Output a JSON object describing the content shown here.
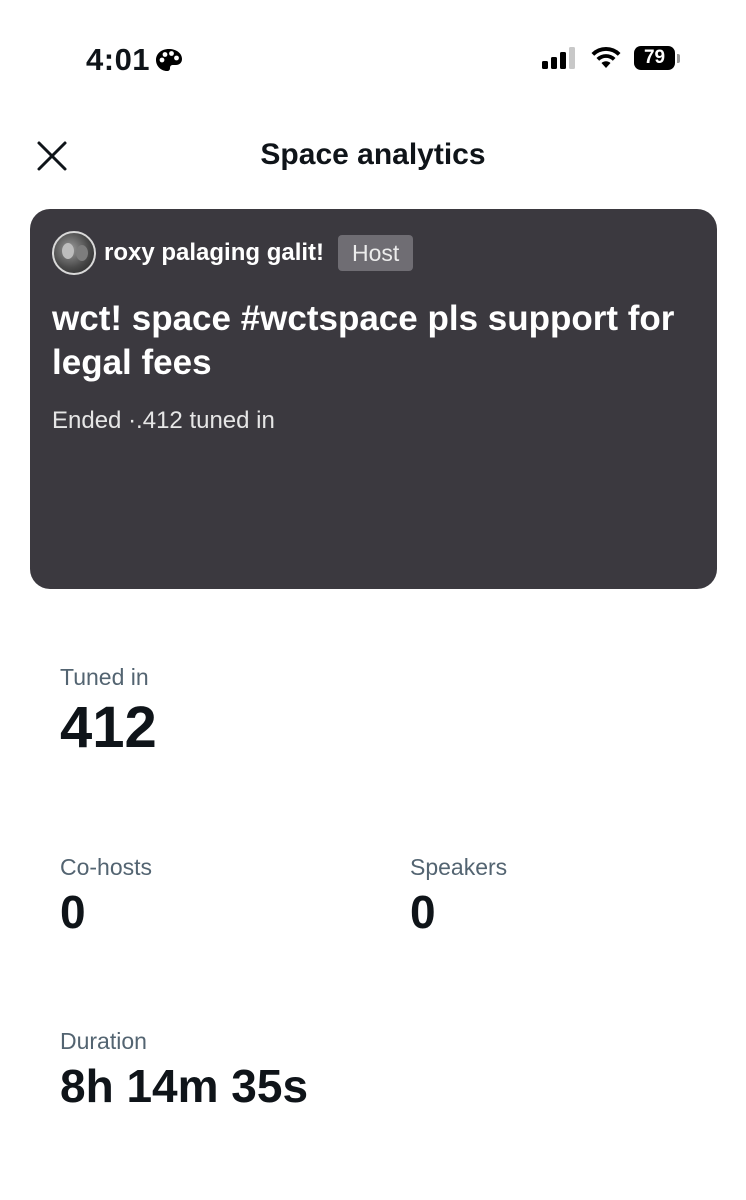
{
  "status_bar": {
    "time": "4:01",
    "battery": "79"
  },
  "header": {
    "title": "Space analytics"
  },
  "space": {
    "host_name": "roxy palaging galit!",
    "host_badge": "Host",
    "title": "wct! space #wctspace pls support for legal fees",
    "status": "Ended ·.412 tuned in"
  },
  "stats": {
    "tuned_in": {
      "label": "Tuned in",
      "value": "412"
    },
    "co_hosts": {
      "label": "Co-hosts",
      "value": "0"
    },
    "speakers": {
      "label": "Speakers",
      "value": "0"
    },
    "duration": {
      "label": "Duration",
      "value": "8h 14m 35s"
    }
  },
  "icons": {
    "close": "close-icon",
    "signal": "cellular-signal-icon",
    "wifi": "wifi-icon",
    "battery": "battery-icon",
    "focus": "palette-icon"
  }
}
